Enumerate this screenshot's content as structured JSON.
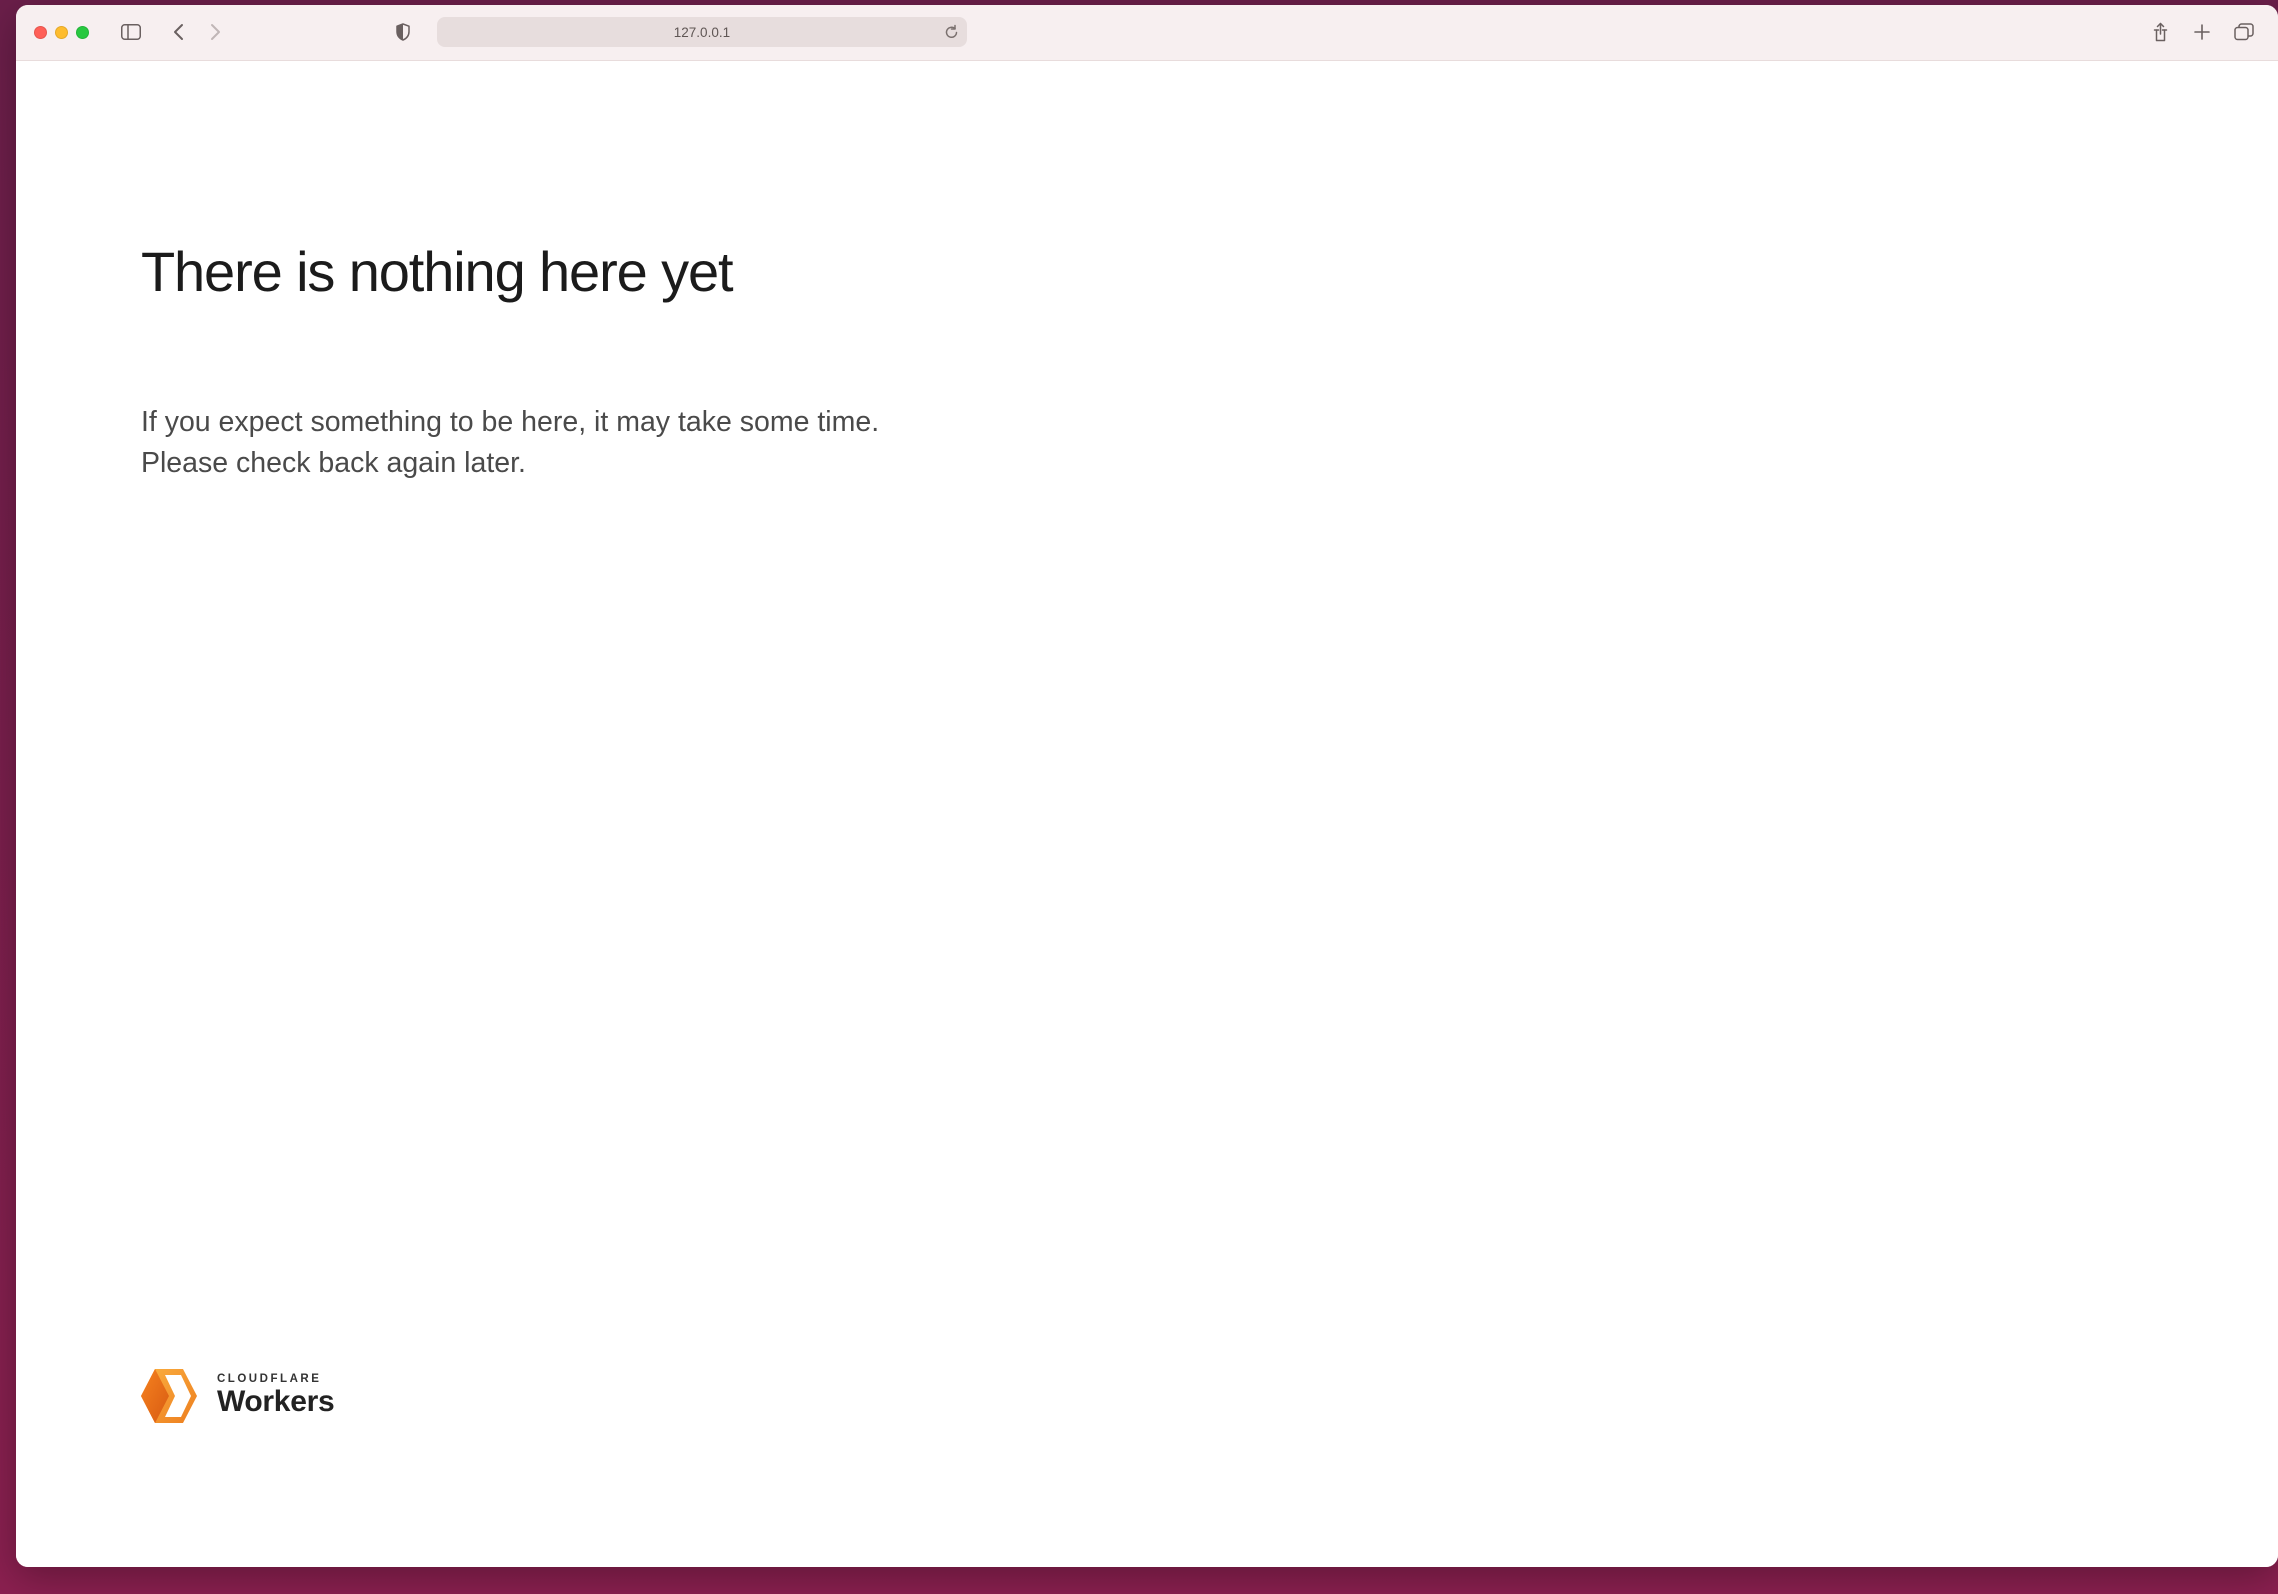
{
  "browser": {
    "address": "127.0.0.1"
  },
  "page": {
    "heading": "There is nothing here yet",
    "message_line1": "If you expect something to be here, it may take some time.",
    "message_line2": "Please check back again later."
  },
  "logo": {
    "sup": "CLOUDFLARE",
    "main": "Workers"
  }
}
